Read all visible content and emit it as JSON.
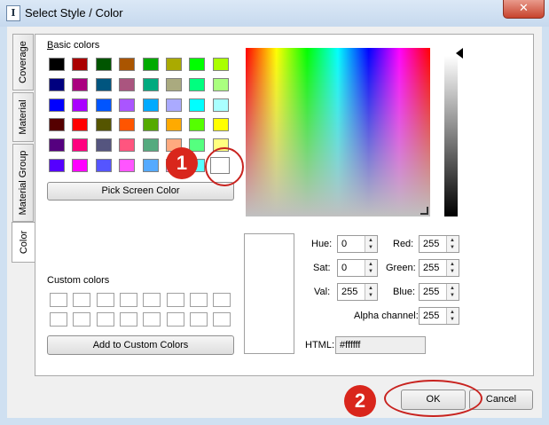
{
  "window": {
    "title": "Select Style / Color",
    "close_glyph": "✕"
  },
  "tabs": [
    {
      "label": "Coverage"
    },
    {
      "label": "Material"
    },
    {
      "label": "Material Group"
    },
    {
      "label": "Color"
    }
  ],
  "basic_colors": {
    "label": "Basic colors",
    "colors": [
      "#000000",
      "#aa0000",
      "#005500",
      "#aa5500",
      "#00aa00",
      "#aaaa00",
      "#00ff00",
      "#aaff00",
      "#00007f",
      "#aa007f",
      "#00557f",
      "#aa557f",
      "#00aa7f",
      "#aaaa7f",
      "#00ff7f",
      "#aaff7f",
      "#0000ff",
      "#aa00ff",
      "#0055ff",
      "#aa55ff",
      "#00aaff",
      "#aaaaff",
      "#00ffff",
      "#aaffff",
      "#550000",
      "#ff0000",
      "#555500",
      "#ff5500",
      "#55aa00",
      "#ffaa00",
      "#55ff00",
      "#ffff00",
      "#55007f",
      "#ff007f",
      "#55557f",
      "#ff557f",
      "#55aa7f",
      "#ffaa7f",
      "#55ff7f",
      "#ffff7f",
      "#5500ff",
      "#ff00ff",
      "#5555ff",
      "#ff55ff",
      "#55aaff",
      "#ffaaff",
      "#55ffff",
      "#ffffff"
    ]
  },
  "pick_screen_color_label": "Pick Screen Color",
  "custom_colors": {
    "label": "Custom colors",
    "count": 16
  },
  "add_custom_label": "Add to Custom Colors",
  "fields": {
    "hue": {
      "label": "Hue:",
      "value": "0"
    },
    "sat": {
      "label": "Sat:",
      "value": "0"
    },
    "val": {
      "label": "Val:",
      "value": "255"
    },
    "red": {
      "label": "Red:",
      "value": "255"
    },
    "green": {
      "label": "Green:",
      "value": "255"
    },
    "blue": {
      "label": "Blue:",
      "value": "255"
    },
    "alpha": {
      "label": "Alpha channel:",
      "value": "255"
    },
    "html": {
      "label": "HTML:",
      "value": "#ffffff"
    }
  },
  "buttons": {
    "ok": "OK",
    "cancel": "Cancel"
  },
  "annotations": {
    "marker1": "1",
    "marker2": "2",
    "color": "#c8231f"
  },
  "current_color": "#ffffff"
}
